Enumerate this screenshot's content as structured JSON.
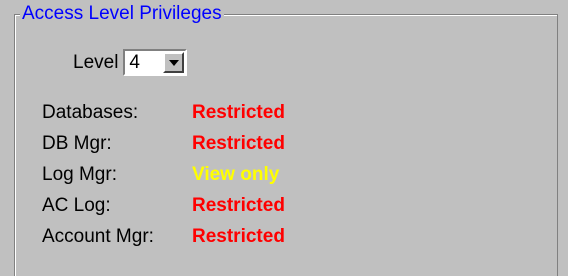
{
  "group": {
    "title": "Access Level Privileges"
  },
  "level": {
    "label": "Level",
    "value": "4"
  },
  "privileges": [
    {
      "label": "Databases:",
      "value": "Restricted",
      "color": "#ff0000"
    },
    {
      "label": "DB Mgr:",
      "value": "Restricted",
      "color": "#ff0000"
    },
    {
      "label": "Log Mgr:",
      "value": "View only",
      "color": "#ffff00"
    },
    {
      "label": "AC Log:",
      "value": "Restricted",
      "color": "#ff0000"
    },
    {
      "label": "Account Mgr:",
      "value": "Restricted",
      "color": "#ff0000"
    }
  ],
  "icons": {
    "dropdown": "dropdown-arrow-icon"
  }
}
